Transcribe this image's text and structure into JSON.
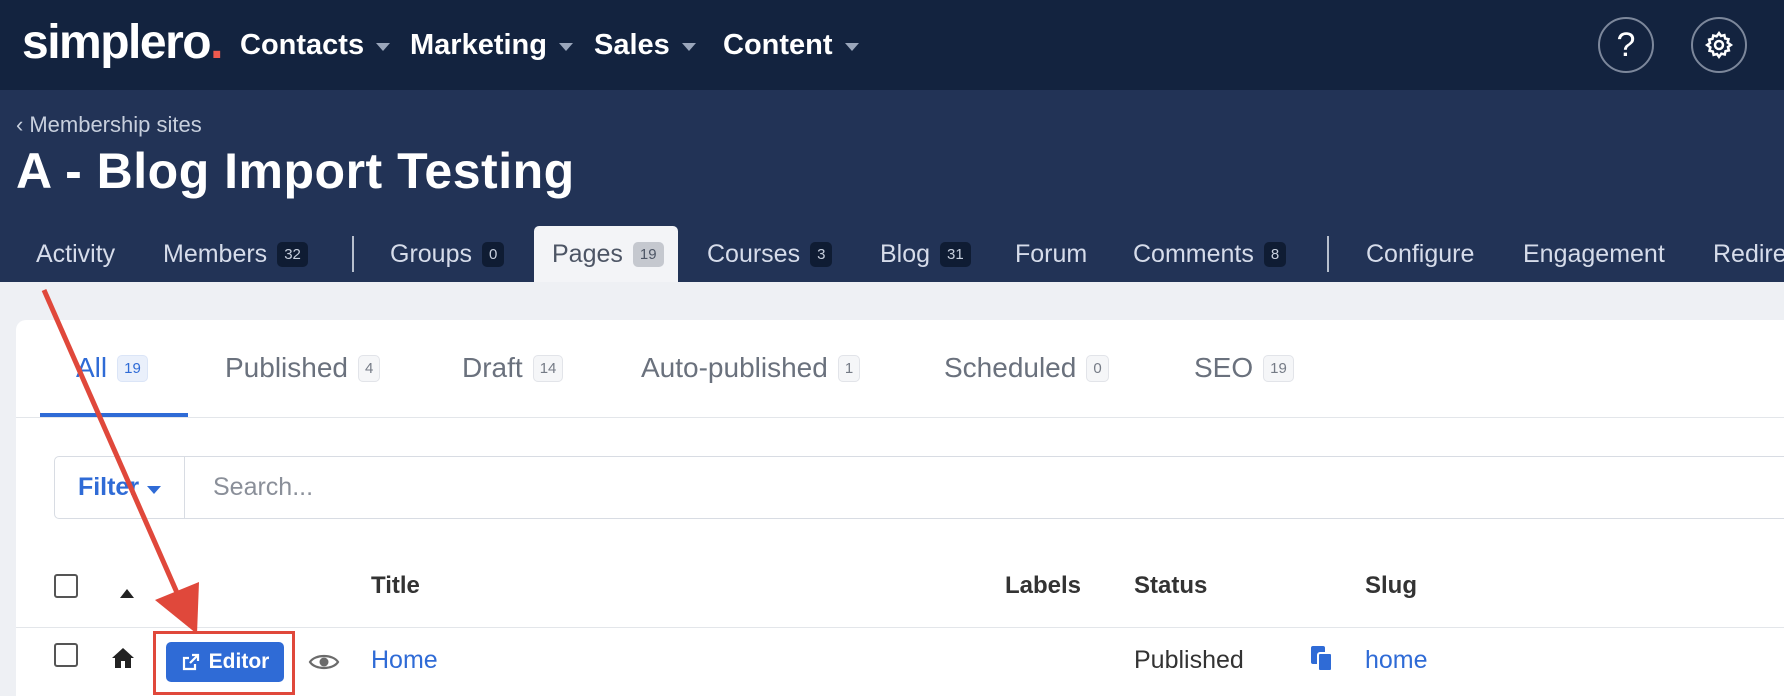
{
  "nav": {
    "logo_main": "simplero",
    "logo_dot": ".",
    "menu": [
      "Contacts",
      "Marketing",
      "Sales",
      "Content"
    ],
    "help_icon": "question-mark-icon",
    "settings_icon": "gear-icon"
  },
  "header": {
    "breadcrumb": "Membership sites",
    "title": "A - Blog Import Testing"
  },
  "tabs": [
    {
      "label": "Activity"
    },
    {
      "label": "Members",
      "count": "32"
    },
    {
      "label": "Groups",
      "count": "0"
    },
    {
      "label": "Pages",
      "count": "19",
      "active": true
    },
    {
      "label": "Courses",
      "count": "3"
    },
    {
      "label": "Blog",
      "count": "31"
    },
    {
      "label": "Forum"
    },
    {
      "label": "Comments",
      "count": "8"
    },
    {
      "label": "Configure"
    },
    {
      "label": "Engagement"
    },
    {
      "label": "Redire"
    }
  ],
  "subtabs": [
    {
      "label": "All",
      "count": "19",
      "active": true
    },
    {
      "label": "Published",
      "count": "4"
    },
    {
      "label": "Draft",
      "count": "14"
    },
    {
      "label": "Auto-published",
      "count": "1"
    },
    {
      "label": "Scheduled",
      "count": "0"
    },
    {
      "label": "SEO",
      "count": "19"
    }
  ],
  "filter": {
    "label": "Filter",
    "search_placeholder": "Search..."
  },
  "table": {
    "columns": {
      "title": "Title",
      "labels": "Labels",
      "status": "Status",
      "slug": "Slug"
    },
    "rows": [
      {
        "editor_label": "Editor",
        "title": "Home",
        "status": "Published",
        "slug": "home"
      }
    ]
  },
  "colors": {
    "nav_bg": "#13233f",
    "header_bg": "#223356",
    "accent": "#2f6bd6",
    "annotation": "#e0483b"
  }
}
